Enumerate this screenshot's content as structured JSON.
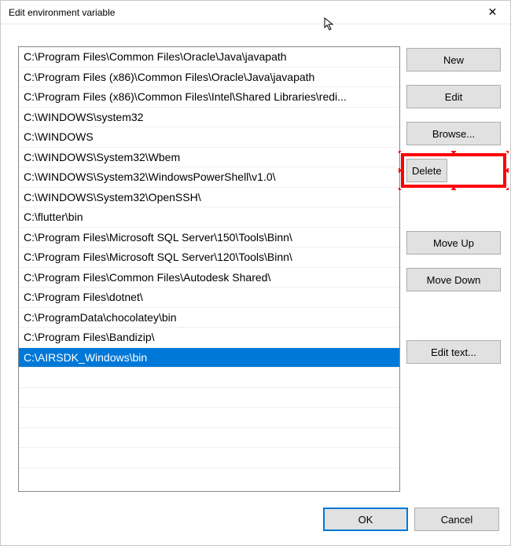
{
  "dialog": {
    "title": "Edit environment variable",
    "close_label": "✕"
  },
  "list": {
    "items": [
      "C:\\Program Files\\Common Files\\Oracle\\Java\\javapath",
      "C:\\Program Files (x86)\\Common Files\\Oracle\\Java\\javapath",
      "C:\\Program Files (x86)\\Common Files\\Intel\\Shared Libraries\\redi...",
      "C:\\WINDOWS\\system32",
      "C:\\WINDOWS",
      "C:\\WINDOWS\\System32\\Wbem",
      "C:\\WINDOWS\\System32\\WindowsPowerShell\\v1.0\\",
      "C:\\WINDOWS\\System32\\OpenSSH\\",
      "C:\\flutter\\bin",
      "C:\\Program Files\\Microsoft SQL Server\\150\\Tools\\Binn\\",
      "C:\\Program Files\\Microsoft SQL Server\\120\\Tools\\Binn\\",
      "C:\\Program Files\\Common Files\\Autodesk Shared\\",
      "C:\\Program Files\\dotnet\\",
      "C:\\ProgramData\\chocolatey\\bin",
      "C:\\Program Files\\Bandizip\\",
      "C:\\AIRSDK_Windows\\bin"
    ],
    "selected_index": 15
  },
  "buttons": {
    "new": "New",
    "edit": "Edit",
    "browse": "Browse...",
    "delete": "Delete",
    "move_up": "Move Up",
    "move_down": "Move Down",
    "edit_text": "Edit text...",
    "ok": "OK",
    "cancel": "Cancel"
  }
}
